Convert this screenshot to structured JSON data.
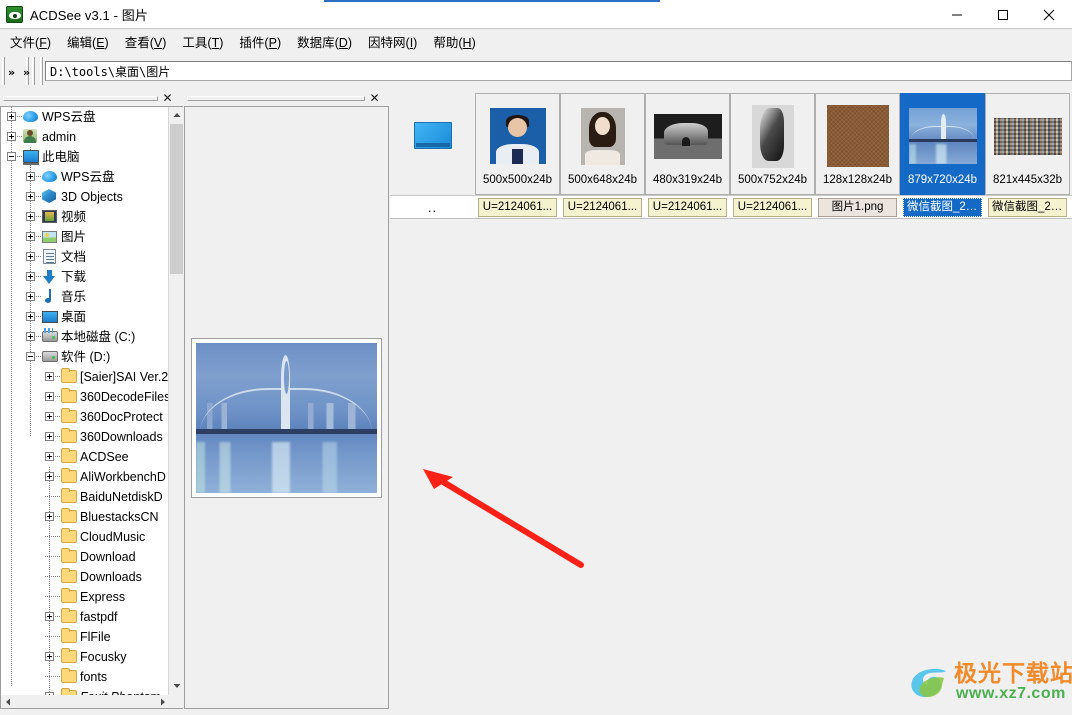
{
  "window": {
    "title": "ACDSee v3.1 - 图片",
    "app_icon": "acdsee-eye-icon",
    "minimize": "–",
    "maximize": "□",
    "close": "✕"
  },
  "menubar": {
    "items": [
      {
        "label": "文件(F)",
        "text": "文件",
        "key": "F"
      },
      {
        "label": "编辑(E)",
        "text": "编辑",
        "key": "E"
      },
      {
        "label": "查看(V)",
        "text": "查看",
        "key": "V"
      },
      {
        "label": "工具(T)",
        "text": "工具",
        "key": "T"
      },
      {
        "label": "插件(P)",
        "text": "插件",
        "key": "P"
      },
      {
        "label": "数据库(D)",
        "text": "数据库",
        "key": "D"
      },
      {
        "label": "因特网(I)",
        "text": "因特网",
        "key": "I"
      },
      {
        "label": "帮助(H)",
        "text": "帮助",
        "key": "H"
      }
    ]
  },
  "toolbar": {
    "overflow_left": "»",
    "overflow_right": "»"
  },
  "address": {
    "value": "D:\\tools\\桌面\\图片",
    "placeholder": ""
  },
  "panels": {
    "tree_close": "✕",
    "preview_close": "✕"
  },
  "tree": {
    "items": [
      {
        "label": "WPS云盘",
        "indent": 0,
        "expander": "plus",
        "icon": "cloud-icon"
      },
      {
        "label": "admin",
        "indent": 0,
        "expander": "plus",
        "icon": "user-icon"
      },
      {
        "label": "此电脑",
        "indent": 0,
        "expander": "minus",
        "icon": "computer-icon"
      },
      {
        "label": "WPS云盘",
        "indent": 1,
        "expander": "plus",
        "icon": "cloud-icon"
      },
      {
        "label": "3D Objects",
        "indent": 1,
        "expander": "plus",
        "icon": "3d-objects-icon"
      },
      {
        "label": "视频",
        "indent": 1,
        "expander": "plus",
        "icon": "video-icon"
      },
      {
        "label": "图片",
        "indent": 1,
        "expander": "plus",
        "icon": "pictures-icon"
      },
      {
        "label": "文档",
        "indent": 1,
        "expander": "plus",
        "icon": "documents-icon"
      },
      {
        "label": "下载",
        "indent": 1,
        "expander": "plus",
        "icon": "downloads-icon"
      },
      {
        "label": "音乐",
        "indent": 1,
        "expander": "plus",
        "icon": "music-icon"
      },
      {
        "label": "桌面",
        "indent": 1,
        "expander": "plus",
        "icon": "desktop-icon"
      },
      {
        "label": "本地磁盘 (C:)",
        "indent": 1,
        "expander": "plus",
        "icon": "drive-c-icon"
      },
      {
        "label": "软件 (D:)",
        "indent": 1,
        "expander": "minus",
        "icon": "drive-icon"
      },
      {
        "label": "[Saier]SAI Ver.2",
        "indent": 2,
        "expander": "plus",
        "icon": "folder-icon"
      },
      {
        "label": "360DecodeFiles",
        "indent": 2,
        "expander": "plus",
        "icon": "folder-icon"
      },
      {
        "label": "360DocProtect",
        "indent": 2,
        "expander": "plus",
        "icon": "folder-icon"
      },
      {
        "label": "360Downloads",
        "indent": 2,
        "expander": "plus",
        "icon": "folder-icon"
      },
      {
        "label": "ACDSee",
        "indent": 2,
        "expander": "plus",
        "icon": "folder-icon"
      },
      {
        "label": "AliWorkbenchD",
        "indent": 2,
        "expander": "plus",
        "icon": "folder-icon"
      },
      {
        "label": "BaiduNetdiskD",
        "indent": 2,
        "expander": "none",
        "icon": "folder-icon"
      },
      {
        "label": "BluestacksCN",
        "indent": 2,
        "expander": "plus",
        "icon": "folder-icon"
      },
      {
        "label": "CloudMusic",
        "indent": 2,
        "expander": "none",
        "icon": "folder-icon"
      },
      {
        "label": "Download",
        "indent": 2,
        "expander": "none",
        "icon": "folder-icon"
      },
      {
        "label": "Downloads",
        "indent": 2,
        "expander": "none",
        "icon": "folder-icon"
      },
      {
        "label": "Express",
        "indent": 2,
        "expander": "none",
        "icon": "folder-icon"
      },
      {
        "label": "fastpdf",
        "indent": 2,
        "expander": "plus",
        "icon": "folder-icon"
      },
      {
        "label": "FlFile",
        "indent": 2,
        "expander": "none",
        "icon": "folder-icon"
      },
      {
        "label": "Focusky",
        "indent": 2,
        "expander": "plus",
        "icon": "folder-icon"
      },
      {
        "label": "fonts",
        "indent": 2,
        "expander": "none",
        "icon": "folder-icon"
      },
      {
        "label": "Foxit Phantom",
        "indent": 2,
        "expander": "plus",
        "icon": "folder-icon"
      }
    ],
    "scroll_up": "⌃",
    "scroll_down": "⌄"
  },
  "thumbnails": {
    "items": [
      {
        "dimensions": "",
        "name": "..",
        "pic": "parent",
        "selected": false,
        "parent": true
      },
      {
        "dimensions": "500x500x24b",
        "name": "U=2124061...",
        "pic": "id1",
        "selected": false
      },
      {
        "dimensions": "500x648x24b",
        "name": "U=2124061...",
        "pic": "id2",
        "selected": false
      },
      {
        "dimensions": "480x319x24b",
        "name": "U=2124061...",
        "pic": "rock1",
        "selected": false
      },
      {
        "dimensions": "500x752x24b",
        "name": "U=2124061...",
        "pic": "rock2",
        "selected": false
      },
      {
        "dimensions": "128x128x24b",
        "name": "图片1.png",
        "pic": "leather",
        "selected": false,
        "png": true
      },
      {
        "dimensions": "879x720x24b",
        "name": "微信截图_20...",
        "pic": "bridge",
        "selected": true
      },
      {
        "dimensions": "821x445x32b",
        "name": "微信截图_20...",
        "pic": "crowd",
        "selected": false
      }
    ]
  },
  "preview": {
    "image_alt": "bridge-night-preview"
  },
  "annotation": {
    "arrow_color": "#fb2116",
    "arrow_from": "580,563",
    "arrow_to": "425,470"
  },
  "watermark": {
    "brand_cn": "极光下载站",
    "url": "www.xz7.com"
  },
  "colors": {
    "selection_blue": "#1469c7",
    "title_accent": "#2b6fc4",
    "chrome_gray": "#f0f0f0",
    "name_chip_bg": "#f5f2d0",
    "watermark_orange": "#f08a2a",
    "watermark_green": "#4caf50"
  }
}
